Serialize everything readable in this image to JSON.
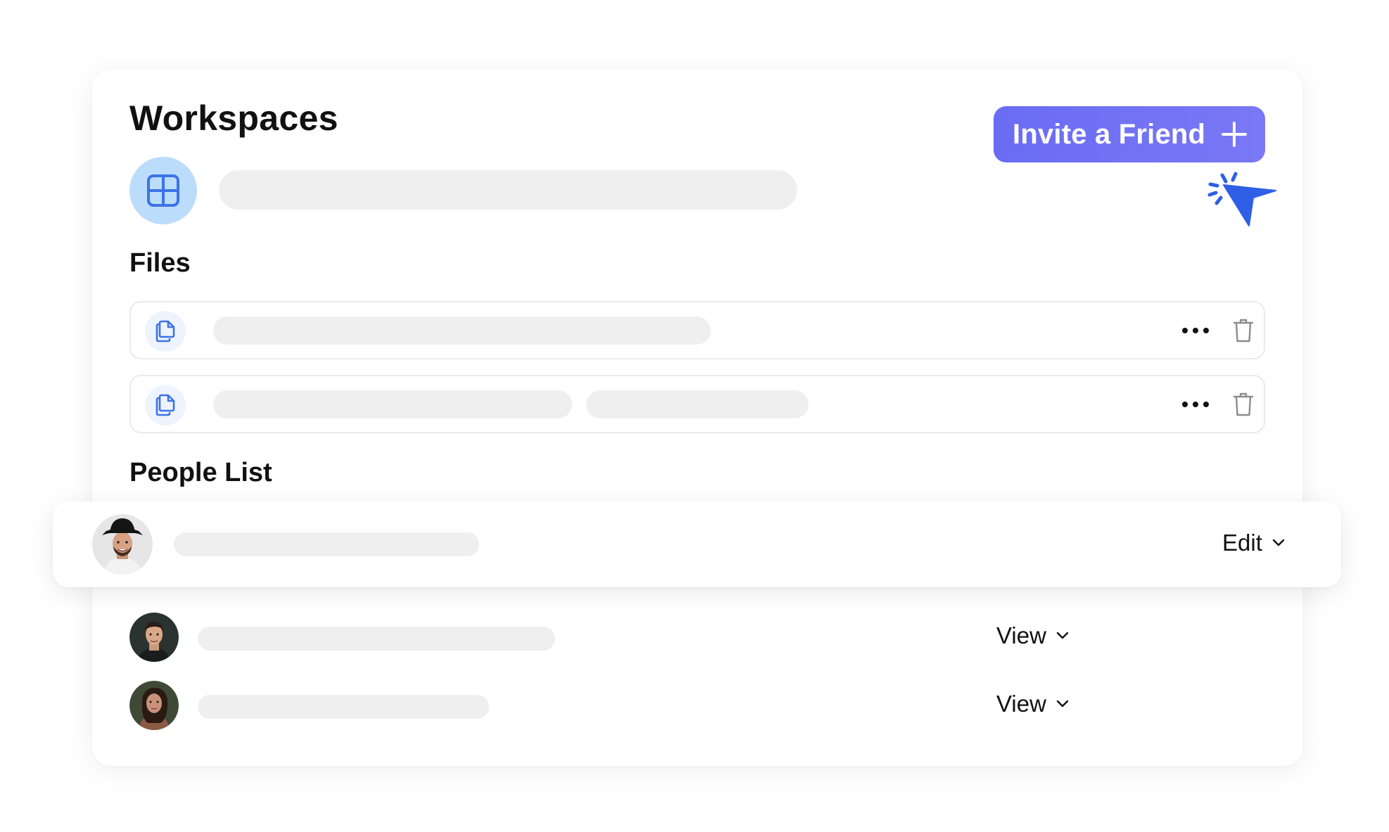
{
  "workspace": {
    "title": "Workspaces",
    "invite_button": {
      "label": "Invite a Friend",
      "icon": "plus-icon"
    },
    "icon": "grid-icon"
  },
  "files": {
    "title": "Files",
    "rows": [
      {
        "icon": "copy-file-icon",
        "more_icon": "more-horizontal-icon",
        "delete_icon": "trash-icon"
      },
      {
        "icon": "copy-file-icon",
        "more_icon": "more-horizontal-icon",
        "delete_icon": "trash-icon"
      }
    ]
  },
  "people": {
    "title": "People List",
    "rows": [
      {
        "permission": "Edit",
        "highlighted": true
      },
      {
        "permission": "View",
        "highlighted": false
      },
      {
        "permission": "View",
        "highlighted": false
      }
    ]
  },
  "colors": {
    "accent": "#6a6cf4",
    "cursor": "#2f5fe6",
    "icon_bg": "#bcdcfb",
    "skeleton": "#efefef",
    "icon_blue": "#3d73e6"
  }
}
